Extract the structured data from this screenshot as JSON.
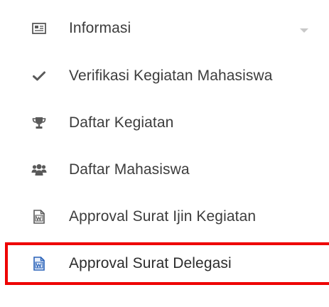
{
  "menu": {
    "items": [
      {
        "label": "Informasi",
        "icon": "newspaper-icon",
        "has_caret": true
      },
      {
        "label": "Verifikasi Kegiatan Mahasiswa",
        "icon": "check-icon"
      },
      {
        "label": "Daftar Kegiatan",
        "icon": "trophy-icon"
      },
      {
        "label": "Daftar Mahasiswa",
        "icon": "users-icon"
      },
      {
        "label": "Approval Surat Ijin Kegiatan",
        "icon": "word-file-icon"
      },
      {
        "label": "Approval Surat Delegasi",
        "icon": "word-file-icon",
        "highlighted": true
      }
    ]
  },
  "colors": {
    "text": "#3c3c3c",
    "icon": "#5a5a5a",
    "highlight_border": "#ee0000",
    "caret": "#c8c8c8",
    "active_icon": "#2a62b8"
  }
}
